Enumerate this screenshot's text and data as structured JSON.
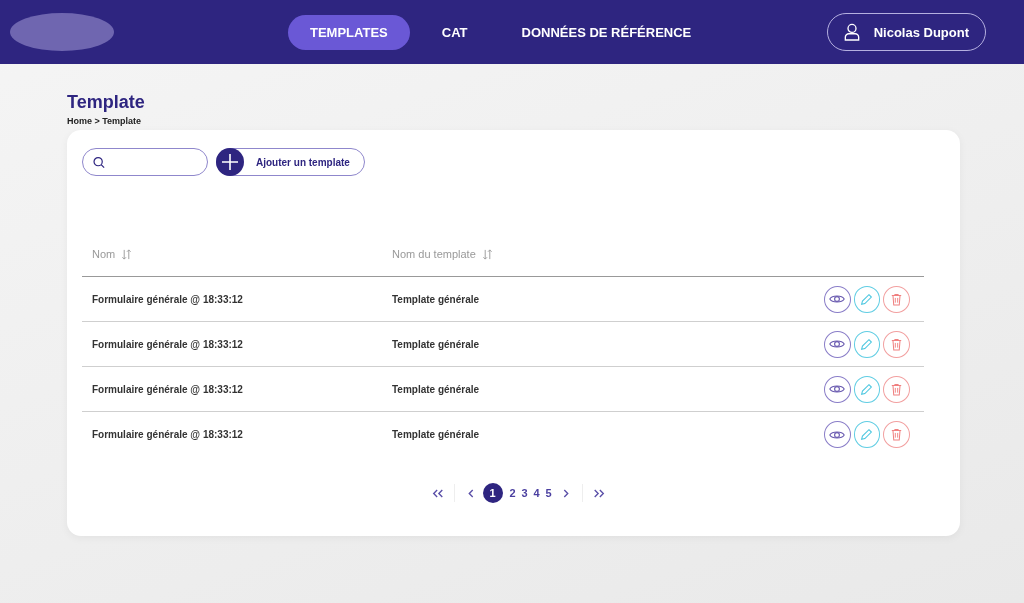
{
  "nav": {
    "tabs": [
      {
        "label": "TEMPLATES",
        "selected": true
      },
      {
        "label": "CAT",
        "selected": false
      },
      {
        "label": "DONNÉES DE RÉFÉRENCE",
        "selected": false
      }
    ],
    "user": "Nicolas Dupont"
  },
  "page": {
    "title": "Template",
    "breadcrumb": "Home > Template"
  },
  "toolbar": {
    "add_button": "Ajouter un template"
  },
  "table": {
    "columns": [
      "Nom",
      "Nom du template"
    ],
    "rows": [
      [
        "Formulaire générale @ 18:33:12",
        "Template générale"
      ],
      [
        "Formulaire générale @ 18:33:12",
        "Template générale"
      ],
      [
        "Formulaire générale @ 18:33:12",
        "Template générale"
      ],
      [
        "Formulaire générale @ 18:33:12",
        "Template générale"
      ]
    ]
  },
  "pagination": {
    "pages": [
      {
        "label": "1",
        "selected": true
      },
      {
        "label": "2",
        "selected": false
      },
      {
        "label": "3",
        "selected": false
      },
      {
        "label": "4",
        "selected": false
      },
      {
        "label": "5",
        "selected": false
      }
    ]
  }
}
